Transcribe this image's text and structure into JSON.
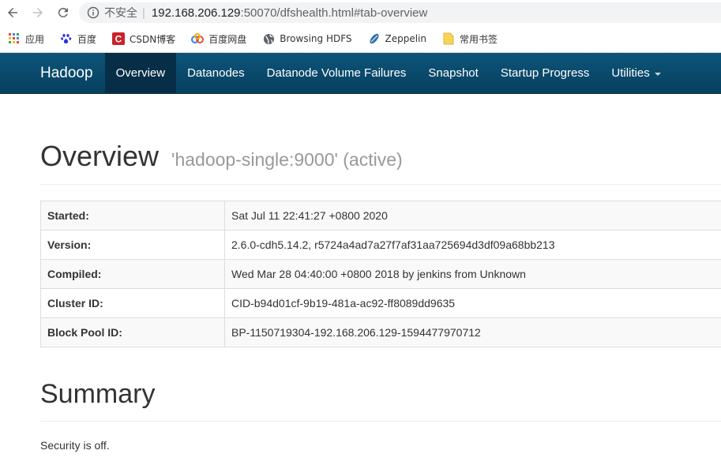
{
  "browser": {
    "insecure_label": "不安全",
    "url_host": "192.168.206.129",
    "url_path": ":50070/dfshealth.html#tab-overview"
  },
  "bookmarks": [
    {
      "label": "应用",
      "icon": "apps-grid-icon"
    },
    {
      "label": "百度",
      "icon": "baidu-paw-icon"
    },
    {
      "label": "CSDN博客",
      "icon": "csdn-icon"
    },
    {
      "label": "百度网盘",
      "icon": "baidu-netdisk-icon"
    },
    {
      "label": "Browsing HDFS",
      "icon": "globe-icon"
    },
    {
      "label": "Zeppelin",
      "icon": "zeppelin-icon"
    },
    {
      "label": "常用书签",
      "icon": "folder-icon"
    }
  ],
  "navbar": {
    "brand": "Hadoop",
    "items": [
      {
        "label": "Overview",
        "active": true
      },
      {
        "label": "Datanodes"
      },
      {
        "label": "Datanode Volume Failures"
      },
      {
        "label": "Snapshot"
      },
      {
        "label": "Startup Progress"
      },
      {
        "label": "Utilities"
      }
    ]
  },
  "overview": {
    "title": "Overview",
    "subtitle": "'hadoop-single:9000' (active)",
    "rows": [
      {
        "label": "Started:",
        "value": "Sat Jul 11 22:41:27 +0800 2020"
      },
      {
        "label": "Version:",
        "value": "2.6.0-cdh5.14.2, r5724a4ad7a27f7af31aa725694d3df09a68bb213"
      },
      {
        "label": "Compiled:",
        "value": "Wed Mar 28 04:40:00 +0800 2018 by jenkins from Unknown"
      },
      {
        "label": "Cluster ID:",
        "value": "CID-b94d01cf-9b19-481a-ac92-ff8089dd9635"
      },
      {
        "label": "Block Pool ID:",
        "value": "BP-1150719304-192.168.206.129-1594477970712"
      }
    ]
  },
  "summary": {
    "title": "Summary",
    "security": "Security is off."
  },
  "colors": {
    "navbar": "#0d5479",
    "navbar_active": "#062f47"
  }
}
